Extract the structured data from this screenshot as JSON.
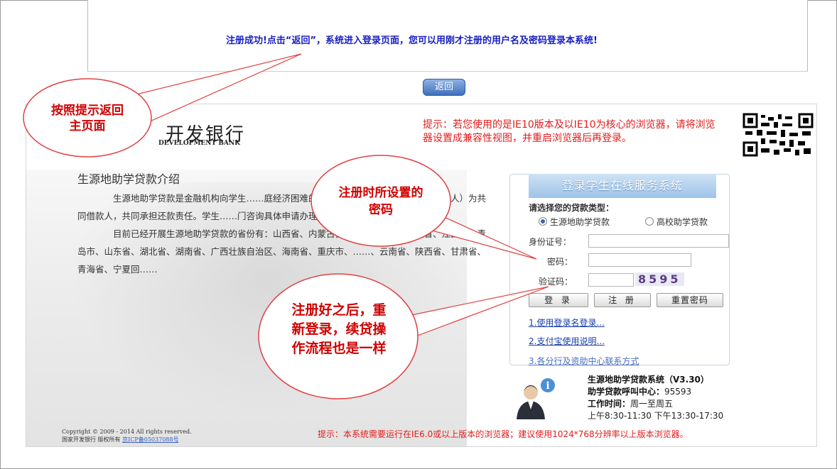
{
  "top": {
    "success_message": "注册成功!点击“返回”，系统进入登录页面，您可以用刚才注册的用户名及密码登录本系统!",
    "back_button": "返回"
  },
  "bank": {
    "name": "开发银行",
    "name_en": "DEVELOPMENT BANK"
  },
  "notice": "提示：若您使用的是IE10版本及以IE10为核心的浏览器，请将浏览器设置成兼容性视图，并重启浏览器后再登录。",
  "intro": {
    "title": "生源地助学贷款介绍",
    "para1": "生源地助学贷款是金融机构向学生……庭经济困难的学生发放的助学贷款。学生和……人）为共同借款人，共同承担还款责任。学生……门咨询具体申请办理生源地信用助学贷款的相……",
    "para2": "目前已经开展生源地助学贷款的省份有：山西省、内蒙古自治区、江苏省、安徽省、江西省、青岛市、山东省、湖北省、湖南省、广西壮族自治区、海南省、重庆市、……、云南省、陕西省、甘肃省、青海省、宁夏回……"
  },
  "login": {
    "header": "登录学生在线服务系统",
    "loan_type_label": "请选择您的贷款类型：",
    "radio_options": [
      "生源地助学贷款",
      "高校助学贷款"
    ],
    "radio_selected": 0,
    "id_label": "身份证号：",
    "password_label": "密码：",
    "captcha_label": "验证码：",
    "captcha_value": "8595",
    "buttons": {
      "login": "登 录",
      "register": "注 册",
      "reset": "重置密码"
    },
    "links": [
      "1.使用登录名登录...",
      "2.支付宝使用说明...",
      "3.各分行及资助中心联系方式"
    ]
  },
  "system_info": {
    "name": "生源地助学贷款系统（V3.30）",
    "hotline_label": "助学贷款呼叫中心：",
    "hotline": "95593",
    "hours_label": "工作时间：",
    "days": "周一至周五",
    "times": "上午8:30-11:30  下午13:30-17:30"
  },
  "footer": {
    "copyright": "Copyright © 2009 - 2014 All rights reserved.",
    "owner": "国家开发银行  版权所有",
    "icp": "京ICP备05037088号",
    "warning": "提示：本系统需要运行在IE6.0或以上版本的浏览器；建议使用1024*768分辨率以上版本浏览器。"
  },
  "annotations": {
    "back_tip": "按照提示返回主页面",
    "password_tip": "注册时所设置的密码",
    "relogin_tip": "注册好之后，重新登录，续贷操作流程也是一样"
  },
  "colors": {
    "annotation_red": "#d00000",
    "notice_red": "#e31c1c",
    "success_blue": "#1a20c0"
  },
  "icons": [
    "qr-code-icon",
    "customer-service-icon"
  ]
}
